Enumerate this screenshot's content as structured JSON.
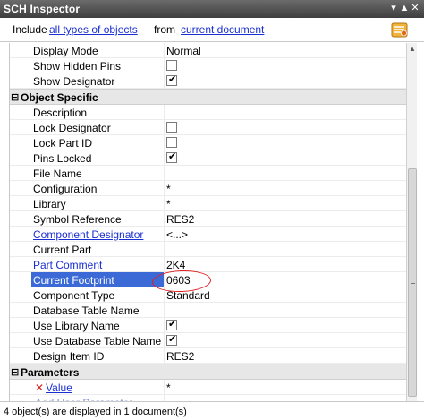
{
  "window": {
    "title": "SCH Inspector"
  },
  "filter": {
    "include_label": "Include",
    "objects_link": "all types of objects",
    "from_label": "from",
    "scope_link": "current document"
  },
  "rows_top": [
    {
      "name": "Display Mode",
      "value": "Normal",
      "type": "text"
    },
    {
      "name": "Show Hidden Pins",
      "value": "",
      "type": "checkbox",
      "checked": false
    },
    {
      "name": "Show Designator",
      "value": "",
      "type": "checkbox",
      "checked": true
    }
  ],
  "categories": {
    "object_specific": "Object Specific",
    "parameters": "Parameters"
  },
  "rows_object": [
    {
      "name": "Description",
      "value": "",
      "type": "text"
    },
    {
      "name": "Lock Designator",
      "value": "",
      "type": "checkbox",
      "checked": false
    },
    {
      "name": "Lock Part ID",
      "value": "",
      "type": "checkbox",
      "checked": false
    },
    {
      "name": "Pins Locked",
      "value": "",
      "type": "checkbox",
      "checked": true
    },
    {
      "name": "File Name",
      "value": "",
      "type": "text"
    },
    {
      "name": "Configuration",
      "value": "*",
      "type": "text"
    },
    {
      "name": "Library",
      "value": "*",
      "type": "text"
    },
    {
      "name": "Symbol Reference",
      "value": "RES2",
      "type": "text"
    },
    {
      "name": "Component Designator",
      "value": "<...>",
      "type": "link"
    },
    {
      "name": "Current Part",
      "value": "",
      "type": "text"
    },
    {
      "name": "Part Comment",
      "value": "2K4",
      "type": "link"
    },
    {
      "name": "Current Footprint",
      "value": "0603",
      "type": "selected"
    },
    {
      "name": "Component Type",
      "value": "Standard",
      "type": "text"
    },
    {
      "name": "Database Table Name",
      "value": "",
      "type": "text"
    },
    {
      "name": "Use Library Name",
      "value": "",
      "type": "checkbox",
      "checked": true
    },
    {
      "name": "Use Database Table Name",
      "value": "",
      "type": "checkbox",
      "checked": true
    },
    {
      "name": "Design Item ID",
      "value": "RES2",
      "type": "text"
    }
  ],
  "rows_params": [
    {
      "name": "Value",
      "value": "*",
      "type": "param"
    },
    {
      "name": "Add User Parameter...",
      "value": "",
      "type": "faded"
    }
  ],
  "status": {
    "text": "4 object(s) are displayed in 1 document(s)"
  },
  "colors": {
    "selection": "#3b6ad6",
    "link": "#1a2fd1",
    "annotation": "#e02020"
  }
}
